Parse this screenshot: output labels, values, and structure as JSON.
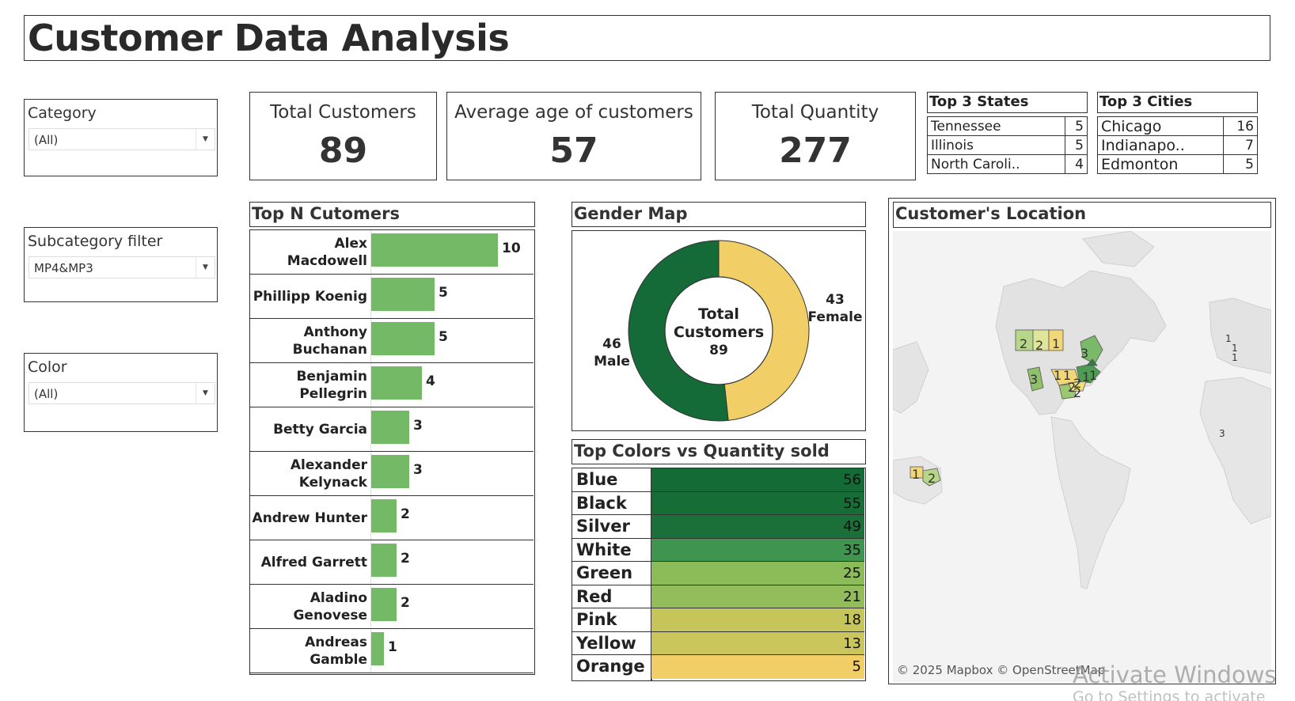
{
  "page_title": "Customer Data Analysis",
  "filters": {
    "category": {
      "label": "Category",
      "value": "(All)"
    },
    "subcategory": {
      "label": "Subcategory filter",
      "value": "MP4&MP3"
    },
    "color": {
      "label": "Color",
      "value": "(All)"
    }
  },
  "kpis": {
    "total_customers": {
      "label": "Total Customers",
      "value": "89"
    },
    "average_age": {
      "label": "Average age of customers",
      "value": "57"
    },
    "total_quantity": {
      "label": "Total Quantity",
      "value": "277"
    }
  },
  "top_states": {
    "title": "Top 3 States",
    "rows": [
      {
        "name": "Tennessee",
        "value": "5"
      },
      {
        "name": "Illinois",
        "value": "5"
      },
      {
        "name": "North Caroli..",
        "value": "4"
      }
    ]
  },
  "top_cities": {
    "title": "Top 3 Cities",
    "rows": [
      {
        "name": "Chicago",
        "value": "16"
      },
      {
        "name": "Indianapo..",
        "value": "7"
      },
      {
        "name": "Edmonton",
        "value": "5"
      }
    ]
  },
  "top_n_customers": {
    "title": "Top N Cutomers",
    "bar_color": "#74b966"
  },
  "gender_map": {
    "title": "Gender Map",
    "center_text": [
      "Total",
      "Customers",
      "89"
    ],
    "male_label": [
      "46",
      "Male"
    ],
    "female_label": [
      "43",
      "Female"
    ],
    "colors": {
      "Male": "#156b37",
      "Female": "#f2cf66"
    }
  },
  "top_colors": {
    "title": "Top Colors vs Quantity sold"
  },
  "customer_location": {
    "title": "Customer's Location",
    "attribution": "© 2025 Mapbox © OpenStreetMap",
    "markers": [
      "2",
      "2",
      "1",
      "3",
      "3",
      "1",
      "1",
      "2",
      "2",
      "1",
      "1",
      "2",
      "1",
      "1",
      "1",
      "3",
      "1",
      "2"
    ]
  },
  "os_overlay": {
    "watermark": "Activate Windows",
    "watermark_sub": "Go to Settings to activate Windows."
  },
  "chart_data": [
    {
      "type": "bar",
      "title": "Top N Cutomers",
      "categories": [
        "Alex Macdowell",
        "Phillipp Koenig",
        "Anthony Buchanan",
        "Benjamin Pellegrin",
        "Betty Garcia",
        "Alexander Kelynack",
        "Andrew Hunter",
        "Alfred Garrett",
        "Aladino Genovese",
        "Andreas Gamble"
      ],
      "values": [
        10,
        5,
        5,
        4,
        3,
        3,
        2,
        2,
        2,
        1
      ],
      "xlim": [
        0,
        10
      ]
    },
    {
      "type": "pie",
      "title": "Gender Map",
      "categories": [
        "Male",
        "Female"
      ],
      "values": [
        46,
        43
      ]
    },
    {
      "type": "heatmap",
      "title": "Top Colors vs Quantity sold",
      "categories": [
        "Blue",
        "Black",
        "Silver",
        "White",
        "Green",
        "Red",
        "Pink",
        "Yellow",
        "Orange"
      ],
      "values": [
        56,
        55,
        49,
        35,
        25,
        21,
        18,
        13,
        5
      ],
      "colors": [
        "#146b35",
        "#166d36",
        "#1b7039",
        "#3f9450",
        "#8cbc5a",
        "#93bd5a",
        "#c5c55a",
        "#cbc65c",
        "#f2cf66"
      ]
    }
  ]
}
